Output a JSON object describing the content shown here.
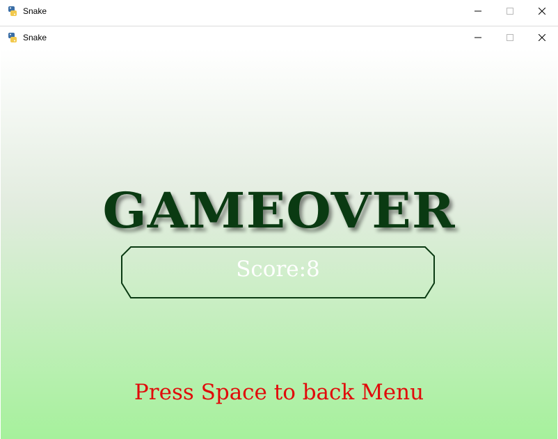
{
  "windows": {
    "back": {
      "title": "Snake",
      "icon": "python-snake-icon"
    },
    "front": {
      "title": "Snake",
      "icon": "python-snake-icon"
    },
    "controls": {
      "minimize": "minimize-icon",
      "maximize": "maximize-icon",
      "close": "close-icon"
    }
  },
  "game": {
    "title": "GAMEOVER",
    "score": "Score:8",
    "prompt": "Press Space to back Menu"
  },
  "colors": {
    "title_text": "#0a3a12",
    "score_border": "#0a3a12",
    "score_text": "#ffffff",
    "prompt_text": "#e10a0a",
    "gradient_top": "#ffffff",
    "gradient_bottom": "#a6f19c"
  }
}
